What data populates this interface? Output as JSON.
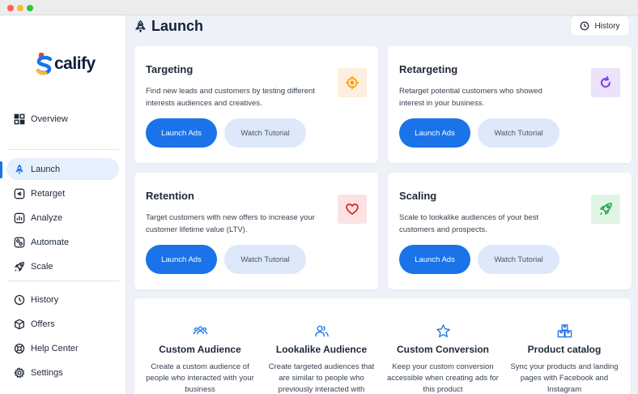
{
  "window": {
    "controls": [
      "close",
      "minimize",
      "maximize"
    ]
  },
  "logo": {
    "mark": "S",
    "text": "calify"
  },
  "sidebar": {
    "items": [
      {
        "label": "Overview",
        "icon": "grid-icon"
      },
      {
        "label": "Launch",
        "icon": "rocket-icon",
        "active": true
      },
      {
        "label": "Retarget",
        "icon": "retarget-icon"
      },
      {
        "label": "Analyze",
        "icon": "chart-icon"
      },
      {
        "label": "Automate",
        "icon": "automate-icon"
      },
      {
        "label": "Scale",
        "icon": "rocket-icon"
      },
      {
        "label": "History",
        "icon": "clock-icon"
      },
      {
        "label": "Offers",
        "icon": "box-icon"
      },
      {
        "label": "Help Center",
        "icon": "lifebuoy-icon"
      },
      {
        "label": "Settings",
        "icon": "gear-icon"
      }
    ]
  },
  "header": {
    "title": "Launch",
    "history_button": "History"
  },
  "cards": [
    {
      "title": "Targeting",
      "description": "Find new leads and customers by testing different interests audiences and creatives.",
      "icon": "crosshair-icon",
      "icon_color": "#f59e0b",
      "icon_bg": "#fdeedd",
      "primary": "Launch Ads",
      "secondary": "Watch Tutorial"
    },
    {
      "title": "Retargeting",
      "description": "Retarget potential customers who showed interest in your business.",
      "icon": "refresh-icon",
      "icon_color": "#7c3aed",
      "icon_bg": "#ece3fb",
      "primary": "Launch Ads",
      "secondary": "Watch Tutorial"
    },
    {
      "title": "Retention",
      "description": "Target customers with new offers to increase your customer lifetime value (LTV).",
      "icon": "heart-icon",
      "icon_color": "#dc2626",
      "icon_bg": "#fbe3e3",
      "primary": "Launch Ads",
      "secondary": "Watch Tutorial"
    },
    {
      "title": "Scaling",
      "description": "Scale to lookalike audiences of your best customers and prospects.",
      "icon": "rocket-icon",
      "icon_color": "#16a34a",
      "icon_bg": "#e1f5e6",
      "primary": "Launch Ads",
      "secondary": "Watch Tutorial"
    }
  ],
  "features": [
    {
      "title": "Custom Audience",
      "description": "Create a custom audience of people who interacted with your business",
      "icon": "people-group-icon"
    },
    {
      "title": "Lookalike Audience",
      "description": "Create targeted audiences that are similar to people who previously interacted with",
      "icon": "users-icon"
    },
    {
      "title": "Custom Conversion",
      "description": "Keep your custom conversion accessible when creating ads for this product",
      "icon": "star-icon"
    },
    {
      "title": "Product catalog",
      "description": "Sync your products and landing pages with Facebook and Instagram",
      "icon": "boxes-icon"
    }
  ],
  "colors": {
    "accent": "#1a73e8",
    "accent_light": "#dde9fa",
    "sidebar_active": "#e5effd",
    "background": "#eef1f7"
  }
}
